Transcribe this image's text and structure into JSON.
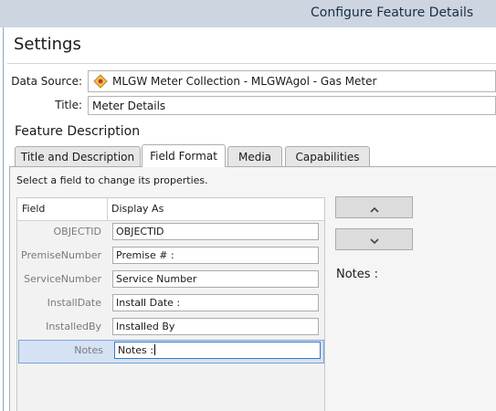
{
  "window": {
    "title": "Configure Feature Details"
  },
  "settings": {
    "heading": "Settings"
  },
  "datasource": {
    "label": "Data Source:",
    "value": "MLGW Meter Collection - MLGWAgol - Gas Meter",
    "icon": "layer-diamond-icon"
  },
  "title_field": {
    "label": "Title:",
    "value": "Meter Details"
  },
  "feature_description": {
    "heading": "Feature Description"
  },
  "tabs": [
    {
      "label": "Title and Description"
    },
    {
      "label": "Field Format"
    },
    {
      "label": "Media"
    },
    {
      "label": "Capabilities"
    }
  ],
  "active_tab": "Field Format",
  "field_format": {
    "hint": "Select a field to change its properties.",
    "columns": {
      "field": "Field",
      "display": "Display As"
    },
    "rows": [
      {
        "field": "OBJECTID",
        "display": "OBJECTID"
      },
      {
        "field": "PremiseNumber",
        "display": "Premise # :"
      },
      {
        "field": "ServiceNumber",
        "display": "Service Number"
      },
      {
        "field": "InstallDate",
        "display": "Install Date :"
      },
      {
        "field": "InstalledBy",
        "display": "Installed By"
      },
      {
        "field": "Notes",
        "display": "Notes :"
      }
    ],
    "selected": "Notes",
    "move_up_icon": "chevron-up-icon",
    "move_down_icon": "chevron-down-icon",
    "selected_label": "Notes :"
  },
  "colors": {
    "selection": "#d5e2f4",
    "titlebar": "#ccd5e0",
    "accent": "#3a78c4"
  }
}
